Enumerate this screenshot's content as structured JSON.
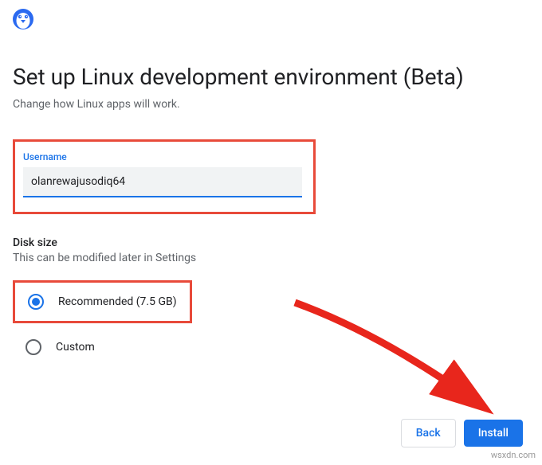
{
  "header": {
    "title": "Set up Linux development environment (Beta)",
    "subtitle": "Change how Linux apps will work."
  },
  "username": {
    "label": "Username",
    "value": "olanrewajusodiq64"
  },
  "disk": {
    "header": "Disk size",
    "sub": "This can be modified later in Settings",
    "options": {
      "recommended": "Recommended (7.5 GB)",
      "custom": "Custom"
    }
  },
  "footer": {
    "back": "Back",
    "install": "Install"
  },
  "watermark": "wsxdn.com"
}
